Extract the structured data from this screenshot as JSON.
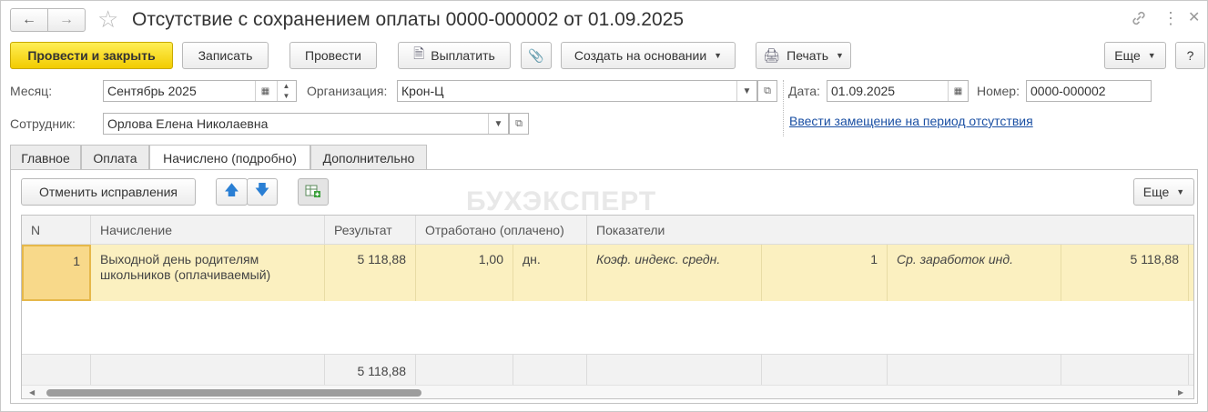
{
  "window": {
    "title": "Отсутствие с сохранением оплаты 0000-000002 от 01.09.2025",
    "icons": [
      "arrow-left-icon",
      "arrow-right-icon",
      "star-icon",
      "link-icon",
      "kebab-menu-icon",
      "close-icon"
    ]
  },
  "toolbar": {
    "post_close": "Провести и закрыть",
    "save": "Записать",
    "post": "Провести",
    "pay": "Выплатить",
    "create_based": "Создать на основании",
    "print": "Печать",
    "more": "Еще",
    "help": "?"
  },
  "form": {
    "month_label": "Месяц:",
    "month_value": "Сентябрь 2025",
    "org_label": "Организация:",
    "org_value": "Крон-Ц",
    "date_label": "Дата:",
    "date_value": "01.09.2025",
    "number_label": "Номер:",
    "number_value": "0000-000002",
    "employee_label": "Сотрудник:",
    "employee_value": "Орлова Елена Николаевна",
    "replacement_link": "Ввести замещение на период отсутствия"
  },
  "tabs": [
    {
      "label": "Главное",
      "active": false
    },
    {
      "label": "Оплата",
      "active": false
    },
    {
      "label": "Начислено (подробно)",
      "active": true
    },
    {
      "label": "Дополнительно",
      "active": false
    }
  ],
  "panel": {
    "cancel_corrections": "Отменить исправления",
    "more": "Еще",
    "watermark": "БУХЭКСПЕРТ"
  },
  "table": {
    "headers": [
      "N",
      "Начисление",
      "Результат",
      "Отработано (оплачено)",
      "Показатели"
    ],
    "rows": [
      {
        "n": "1",
        "accrual": "Выходной день родителям школьников (оплачиваемый)",
        "result": "5 118,88",
        "worked": "1,00",
        "unit": "дн.",
        "ind1_name": "Коэф. индекс. средн.",
        "ind1_value": "1",
        "ind2_name": "Ср. заработок инд.",
        "ind2_value": "5 118,88"
      }
    ],
    "footer_result": "5 118,88"
  },
  "colors": {
    "primary_button": "#f2cc00",
    "selected_row": "#fbf0c0",
    "link": "#1a4fa3"
  }
}
